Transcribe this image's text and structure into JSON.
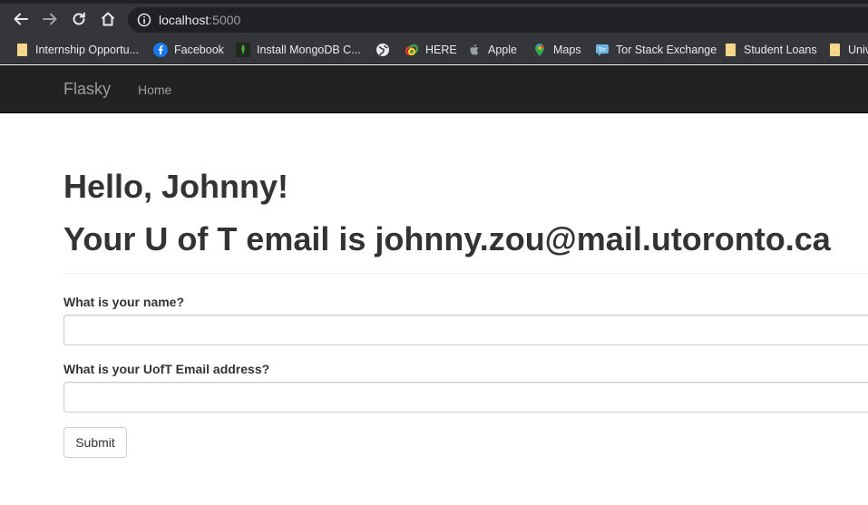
{
  "browser": {
    "url_host": "localhost",
    "url_port": ":5000",
    "bookmarks": [
      {
        "label": "Internship Opportu...",
        "icon": "folder-icon"
      },
      {
        "label": "Facebook",
        "icon": "facebook-icon"
      },
      {
        "label": "Install MongoDB C...",
        "icon": "mongodb-leaf-icon"
      },
      {
        "label": "",
        "icon": "globe-icon"
      },
      {
        "label": "HERE",
        "icon": "here-icon"
      },
      {
        "label": "Apple",
        "icon": "apple-icon"
      },
      {
        "label": "Maps",
        "icon": "maps-pin-icon"
      },
      {
        "label": "Tor Stack Exchange",
        "icon": "tor-stackexchange-icon"
      },
      {
        "label": "Student Loans",
        "icon": "folder-icon"
      },
      {
        "label": "Univ",
        "icon": "folder-icon"
      }
    ]
  },
  "navbar": {
    "brand": "Flasky",
    "home": "Home"
  },
  "page": {
    "greeting": "Hello, Johnny!",
    "email_line": "Your U of T email is johnny.zou@mail.utoronto.ca"
  },
  "form": {
    "name_label": "What is your name?",
    "name_value": "",
    "email_label": "What is your UofT Email address?",
    "email_value": "",
    "submit_label": "Submit"
  }
}
